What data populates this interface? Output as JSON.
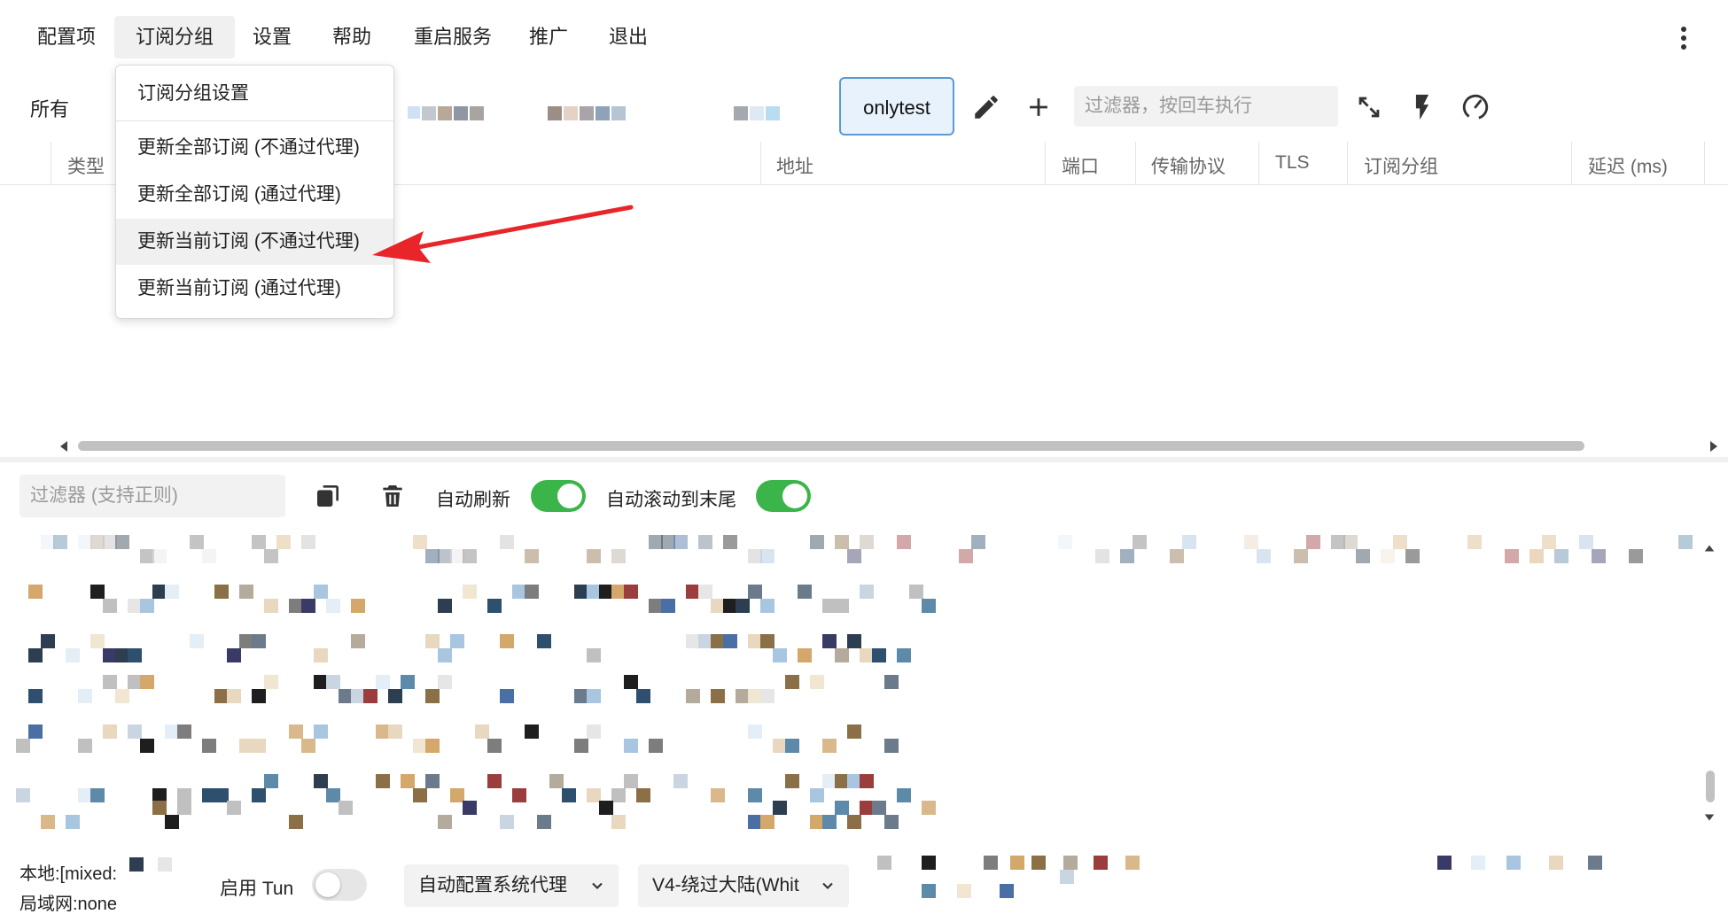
{
  "menubar": {
    "items": [
      "配置项",
      "订阅分组",
      "设置",
      "帮助",
      "重启服务",
      "推广",
      "退出"
    ],
    "active_index": 1
  },
  "toolbar": {
    "all_label": "所有",
    "group_button": "onlytest",
    "filter_placeholder": "过滤器，按回车执行"
  },
  "dropdown": {
    "items": [
      "订阅分组设置",
      "更新全部订阅 (不通过代理)",
      "更新全部订阅 (通过代理)",
      "更新当前订阅 (不通过代理)",
      "更新当前订阅 (通过代理)"
    ],
    "highlighted_index": 3
  },
  "table": {
    "columns": [
      "类型",
      "地址",
      "端口",
      "传输协议",
      "TLS",
      "订阅分组",
      "延迟 (ms)"
    ]
  },
  "log_panel": {
    "filter_placeholder": "过滤器 (支持正则)",
    "auto_refresh_label": "自动刷新",
    "auto_refresh_on": true,
    "auto_scroll_label": "自动滚动到末尾",
    "auto_scroll_on": true
  },
  "statusbar": {
    "local_label": "本地:[mixed:",
    "lan_label": "局域网:none",
    "tun_label": "启用 Tun",
    "tun_on": false,
    "sysproxy_select": "自动配置系统代理",
    "routing_select": "V4-绕过大陆(Whit"
  },
  "colors": {
    "accent_toggle": "#3bb54a",
    "selected_button_bg": "#e8f2fc",
    "selected_button_border": "#5a9bd4",
    "annotation_arrow": "#e8262a"
  },
  "icons": [
    "pencil-icon",
    "plus-icon",
    "expand-icon",
    "lightning-icon",
    "speedometer-icon",
    "copy-icon",
    "trash-icon",
    "chevron-down-icon",
    "kebab-icon",
    "arrow-left-icon",
    "arrow-right-icon",
    "arrow-up-icon",
    "arrow-down-icon"
  ]
}
